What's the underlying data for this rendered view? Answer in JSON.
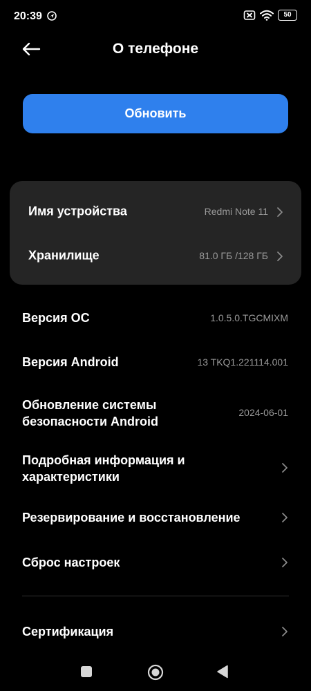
{
  "status": {
    "time": "20:39",
    "battery": "50",
    "icons": [
      "location-icon",
      "no-sim-icon",
      "wifi-icon",
      "battery-icon"
    ]
  },
  "header": {
    "title": "О телефоне",
    "back_icon": "arrow-left-icon"
  },
  "update_button": {
    "label": "Обновить"
  },
  "card": {
    "device_name": {
      "label": "Имя устройства",
      "value": "Redmi Note 11"
    },
    "storage": {
      "label": "Хранилище",
      "value": "81.0 ГБ /128 ГБ"
    }
  },
  "info": {
    "os_version": {
      "label": "Версия ОС",
      "value": "1.0.5.0.TGCMIXM"
    },
    "android_version": {
      "label": "Версия Android",
      "value": "13 TKQ1.221114.001"
    },
    "security_update": {
      "label_line1": "Обновление системы",
      "label_line2": "безопасности Android",
      "value": "2024-06-01"
    },
    "details": {
      "label_line1": "Подробная информация и",
      "label_line2": "характеристики"
    },
    "backup": {
      "label": "Резервирование и восстановление"
    },
    "reset": {
      "label": "Сброс настроек"
    },
    "certification": {
      "label": "Сертификация"
    }
  },
  "colors": {
    "background": "#000000",
    "accent": "#2f80ed",
    "card": "#252525",
    "secondary_text": "#9a9a9a"
  }
}
